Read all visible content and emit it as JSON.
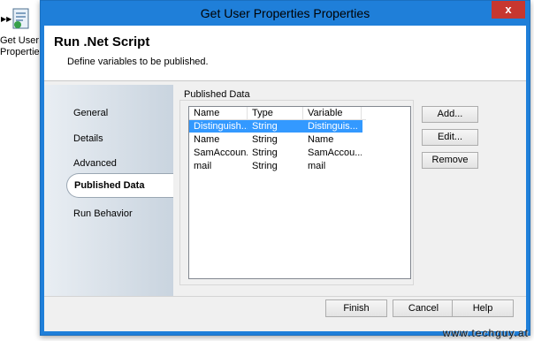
{
  "background": {
    "activity_label_line1": "Get User",
    "activity_label_line2": "Properties"
  },
  "window": {
    "title": "Get User Properties Properties",
    "close_glyph": "x"
  },
  "header": {
    "title": "Run .Net Script",
    "subtitle": "Define variables to be published."
  },
  "nav": {
    "items": [
      "General",
      "Details",
      "Advanced",
      "Published Data",
      "Run Behavior"
    ],
    "selected": "Published Data"
  },
  "published_data": {
    "group_label": "Published Data",
    "columns": [
      "Name",
      "Type",
      "Variable"
    ],
    "rows": [
      {
        "name": "Distinguish...",
        "type": "String",
        "variable": "Distinguis...",
        "selected": true
      },
      {
        "name": "Name",
        "type": "String",
        "variable": "Name",
        "selected": false
      },
      {
        "name": "SamAccoun...",
        "type": "String",
        "variable": "SamAccou...",
        "selected": false
      },
      {
        "name": "mail",
        "type": "String",
        "variable": "mail",
        "selected": false
      }
    ]
  },
  "side_buttons": {
    "add": "Add...",
    "edit": "Edit...",
    "remove": "Remove"
  },
  "footer_buttons": {
    "finish": "Finish",
    "cancel": "Cancel",
    "help": "Help"
  },
  "watermark": "www.techguy.at",
  "colors": {
    "accent": "#1f7fd9",
    "selection": "#3399ff",
    "close": "#c7372f"
  }
}
